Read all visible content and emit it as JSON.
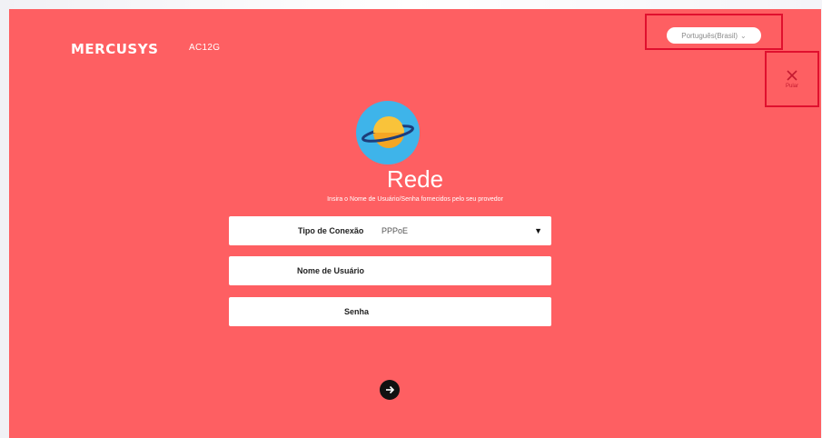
{
  "header": {
    "brand": "MERCUSYS",
    "model": "AC12G",
    "language": "Português(Brasil)",
    "close_label": "Pular"
  },
  "main": {
    "icon": "globe-icon",
    "title": "Rede",
    "subtitle": "Insira o Nome de Usuário/Senha fornecidos pelo seu provedor",
    "fields": [
      {
        "label": "Tipo de Conexão",
        "value": "PPPoE"
      },
      {
        "label": "Nome de Usuário",
        "value": ""
      },
      {
        "label": "Senha",
        "value": ""
      }
    ]
  },
  "colors": {
    "background": "#fe5f62",
    "highlight_frame": "#e0102e",
    "globe_circle": "#3eb4ea",
    "globe_planet": "#f9c33a"
  },
  "icons": {
    "close": "close-icon",
    "dropdown": "dropdown-arrow-icon",
    "next": "arrow-right-icon"
  }
}
